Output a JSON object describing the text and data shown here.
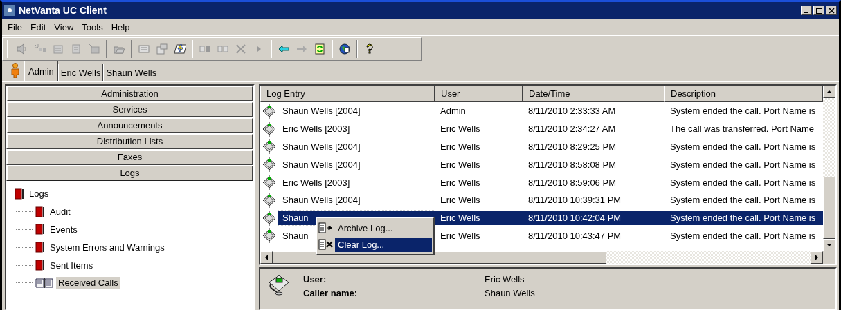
{
  "window": {
    "title": "NetVanta UC Client"
  },
  "menu": [
    "File",
    "Edit",
    "View",
    "Tools",
    "Help"
  ],
  "tabs": [
    {
      "label": "Admin",
      "selected": true
    },
    {
      "label": "Eric Wells",
      "selected": false
    },
    {
      "label": "Shaun Wells",
      "selected": false
    }
  ],
  "sections": [
    {
      "label": "Administration",
      "selected": false
    },
    {
      "label": "Services",
      "selected": false
    },
    {
      "label": "Announcements",
      "selected": false
    },
    {
      "label": "Distribution Lists",
      "selected": false
    },
    {
      "label": "Faxes",
      "selected": false
    },
    {
      "label": "Logs",
      "selected": true
    }
  ],
  "tree": {
    "label": "Logs",
    "kind": "log",
    "selected": false,
    "children": [
      {
        "label": "Audit",
        "kind": "log",
        "selected": false
      },
      {
        "label": "Events",
        "kind": "log",
        "selected": false
      },
      {
        "label": "System Errors and Warnings",
        "kind": "log",
        "selected": false
      },
      {
        "label": "Sent Items",
        "kind": "log",
        "selected": false
      },
      {
        "label": "Received Calls",
        "kind": "book",
        "selected": true
      }
    ]
  },
  "table": {
    "columns": [
      "Log Entry",
      "User",
      "Date/Time",
      "Description"
    ],
    "rows": [
      {
        "cells": [
          "Shaun Wells [2004]",
          "Admin",
          "8/11/2010 2:33:33 AM",
          "System ended the call. Port Name is"
        ],
        "selected": false
      },
      {
        "cells": [
          "Eric Wells [2003]",
          "Eric Wells",
          "8/11/2010 2:34:27 AM",
          "The call was transferred. Port Name"
        ],
        "selected": false
      },
      {
        "cells": [
          "Shaun Wells [2004]",
          "Eric Wells",
          "8/11/2010 8:29:25 PM",
          "System ended the call. Port Name is"
        ],
        "selected": false
      },
      {
        "cells": [
          "Shaun Wells [2004]",
          "Eric Wells",
          "8/11/2010 8:58:08 PM",
          "System ended the call. Port Name is"
        ],
        "selected": false
      },
      {
        "cells": [
          "Eric Wells [2003]",
          "Eric Wells",
          "8/11/2010 8:59:06 PM",
          "System ended the call. Port Name is"
        ],
        "selected": false
      },
      {
        "cells": [
          "Shaun Wells [2004]",
          "Eric Wells",
          "8/11/2010 10:39:31 PM",
          "System ended the call. Port Name is"
        ],
        "selected": false
      },
      {
        "cells": [
          "Shaun",
          "Eric Wells",
          "8/11/2010 10:42:04 PM",
          "System ended the call. Port Name is"
        ],
        "selected": true
      },
      {
        "cells": [
          "Shaun",
          "Eric Wells",
          "8/11/2010 10:43:47 PM",
          "System ended the call. Port Name is"
        ],
        "selected": false
      }
    ]
  },
  "context_menu": [
    {
      "label": "Archive Log...",
      "kind": "archive",
      "selected": false
    },
    {
      "label": "Clear Log...",
      "kind": "clear",
      "selected": true
    }
  ],
  "details": [
    {
      "label": "User:",
      "value": "Eric Wells"
    },
    {
      "label": "Caller name:",
      "value": "Shaun Wells"
    }
  ]
}
